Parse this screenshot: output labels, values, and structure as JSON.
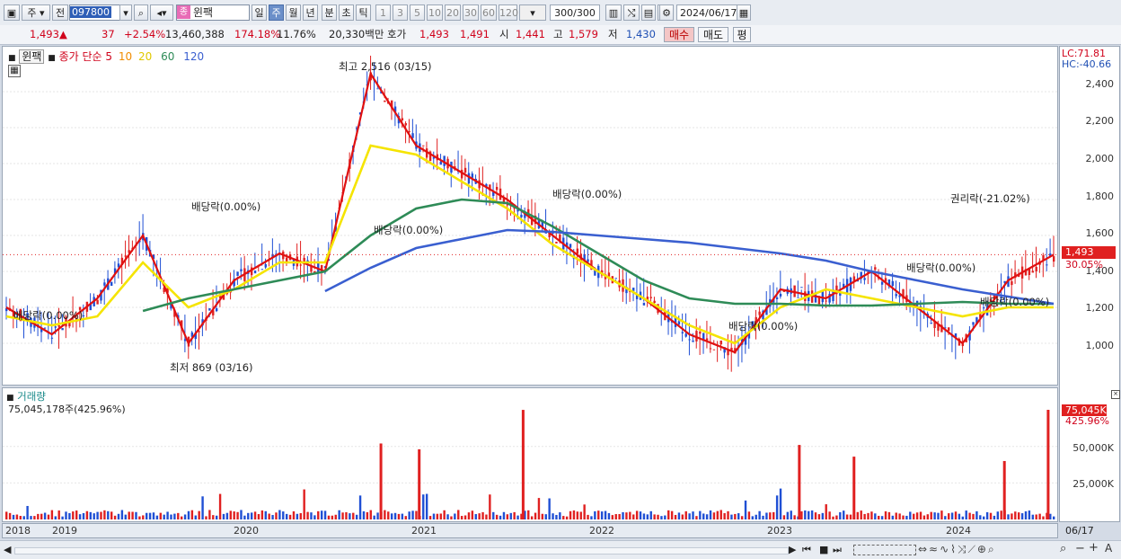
{
  "toolbar": {
    "period_type": "주",
    "prev_label": "전",
    "stock_code": "097800",
    "stock_name": "윈팩",
    "stock_badge": "종",
    "period_buttons": [
      "일",
      "주",
      "월",
      "년",
      "분",
      "초",
      "틱"
    ],
    "active_period": "주",
    "interval_buttons": [
      "1",
      "3",
      "5",
      "10",
      "20",
      "30",
      "60",
      "120"
    ],
    "count": "300/300",
    "date": "2024/06/17"
  },
  "quote": {
    "price": "1,493",
    "change_arrow": "▲",
    "change": "37",
    "change_pct": "+2.54%",
    "volume": "13,460,388",
    "volume_ratio": "174.18%",
    "turnover": "11.76%",
    "amount": "20,330백만",
    "hoga_label": "호가",
    "ask": "1,493",
    "bid": "1,491",
    "open_label": "시",
    "open": "1,441",
    "high_label": "고",
    "high": "1,579",
    "low_label": "저",
    "low": "1,430",
    "buy_label": "매수",
    "sell_label": "매도",
    "eval_label": "평"
  },
  "price_panel": {
    "tab_name": "윈팩",
    "legend_prefix": "종가 단순",
    "ma_periods": [
      "5",
      "10",
      "20",
      "60",
      "120"
    ],
    "ma_colors": [
      "#e01010",
      "#f08c00",
      "#f5e400",
      "#2e8b57",
      "#3a5fd0"
    ],
    "lc": "LC:71.81",
    "hc": "HC:-40.66",
    "current_price": "1,493",
    "current_pct": "30.05%",
    "y_ticks": [
      "2,400",
      "2,200",
      "2,000",
      "1,800",
      "1,600",
      "1,400",
      "1,200",
      "1,000"
    ],
    "annotations": {
      "high": "최고 2,516 (03/15)",
      "low": "최저 869 (03/16)",
      "div1": "배당락(0.00%)",
      "div2": "배당락(0.00%)",
      "div3": "배당락(0.00%)",
      "div4": "배당락(0.00%)",
      "div5": "배당락(0.00%)",
      "div6": "배당락(0.00%)",
      "rights": "권리락(-21.02%)",
      "div7": "배당락(0.00%)"
    }
  },
  "volume_panel": {
    "title": "거래량",
    "value": "75,045,178주(425.96%)",
    "current": "75,045K",
    "current_pct": "425.96%",
    "y_ticks": [
      "50,000K",
      "25,000K"
    ]
  },
  "x_axis": {
    "labels": [
      "2018",
      "2019",
      "2020",
      "2021",
      "2022",
      "2023",
      "2024"
    ],
    "right_label": "06/17"
  },
  "chart_data": {
    "type": "line",
    "title": "",
    "x": [
      "2018",
      "2019",
      "2020",
      "2021",
      "2022",
      "2023",
      "2024"
    ],
    "ylim": [
      850,
      2550
    ],
    "series": [
      {
        "name": "5",
        "values": [
          1200,
          1050,
          1250,
          1600,
          1000,
          1350,
          1500,
          1400,
          2500,
          2100,
          1950,
          1800,
          1600,
          1400,
          1250,
          1050,
          950,
          1300,
          1250,
          1400,
          1200,
          1000,
          1350,
          1493
        ]
      },
      {
        "name": "20",
        "values": [
          1150,
          1100,
          1150,
          1450,
          1200,
          1300,
          1450,
          1450,
          2100,
          2050,
          1900,
          1750,
          1550,
          1400,
          1250,
          1100,
          1000,
          1200,
          1300,
          1250,
          1200,
          1150,
          1200,
          1200
        ]
      },
      {
        "name": "60",
        "values": [
          null,
          null,
          null,
          1180,
          1250,
          1300,
          1350,
          1400,
          1600,
          1750,
          1800,
          1780,
          1650,
          1500,
          1350,
          1250,
          1220,
          1220,
          1210,
          1210,
          1220,
          1230,
          1220,
          1220
        ]
      },
      {
        "name": "120",
        "values": [
          null,
          null,
          null,
          null,
          null,
          null,
          null,
          1290,
          1420,
          1530,
          1580,
          1630,
          1620,
          1600,
          1580,
          1560,
          1530,
          1500,
          1460,
          1400,
          1350,
          1300,
          1260,
          1220
        ]
      }
    ],
    "volume_ylim": [
      0,
      75045
    ],
    "volume_peaks_k": [
      {
        "x": "2020-10",
        "v": 52000
      },
      {
        "x": "2021-01",
        "v": 48000
      },
      {
        "x": "2021-06",
        "v": 75000
      },
      {
        "x": "2023-01",
        "v": 51000
      },
      {
        "x": "2023-05",
        "v": 43000
      },
      {
        "x": "2024-03",
        "v": 40000
      },
      {
        "x": "2024-06",
        "v": 75045
      }
    ]
  }
}
